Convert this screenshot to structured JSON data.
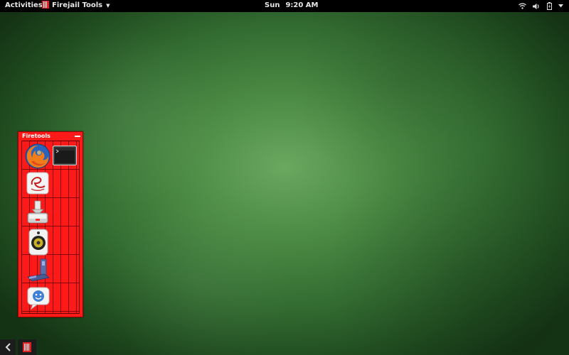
{
  "topbar": {
    "activities": "Activities",
    "app_menu_label": "Firejail Tools",
    "clock_day": "Sun",
    "clock_time": "9:20 AM"
  },
  "firetools": {
    "title": "Firetools",
    "apps": [
      {
        "name": "firefox",
        "icon": "firefox-icon"
      },
      {
        "name": "terminal",
        "icon": "terminal-icon"
      },
      {
        "name": "email",
        "icon": "email-client-icon"
      },
      {
        "name": "transmission",
        "icon": "download-icon"
      },
      {
        "name": "audio player",
        "icon": "speaker-icon"
      },
      {
        "name": "vlc / media",
        "icon": "media-icon"
      },
      {
        "name": "pidgin",
        "icon": "chat-icon"
      }
    ]
  },
  "colors": {
    "panel": "#000000",
    "firetools_bg": "#ff1a1a",
    "desktop_center": "#6aa860",
    "desktop_edge": "#143214"
  }
}
